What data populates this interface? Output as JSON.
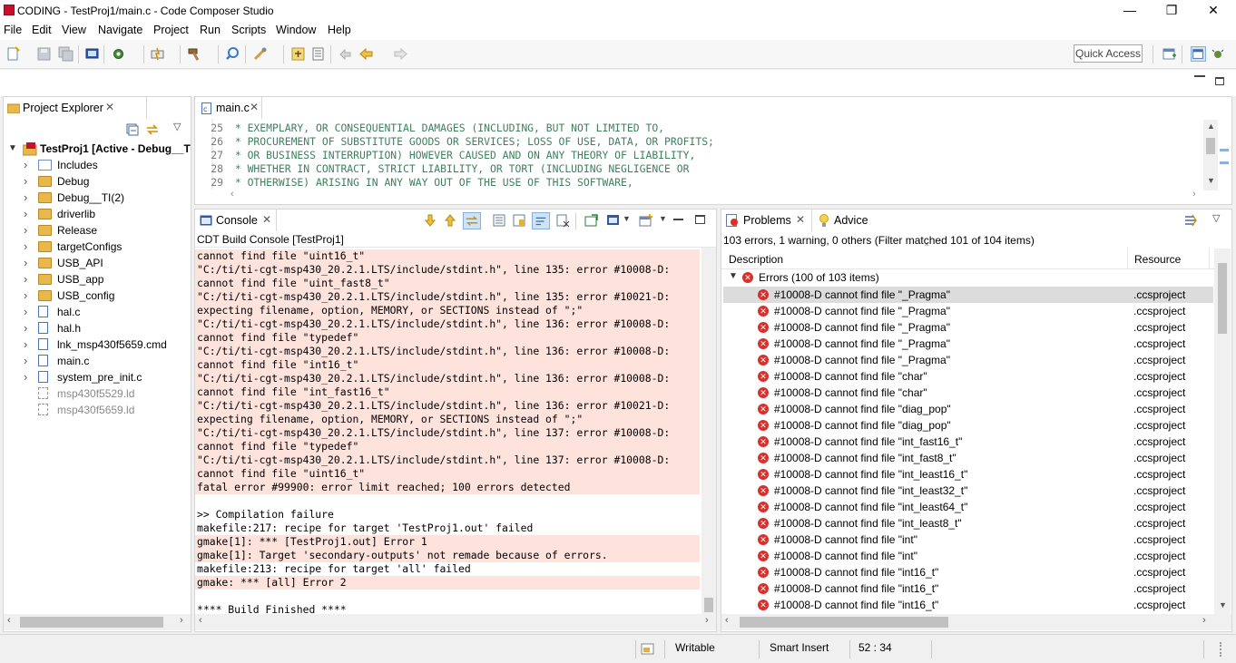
{
  "window": {
    "title": "CODING - TestProj1/main.c - Code Composer Studio",
    "minimize": "—",
    "restore": "❐",
    "close": "✕"
  },
  "menu": [
    "File",
    "Edit",
    "View",
    "Navigate",
    "Project",
    "Run",
    "Scripts",
    "Window",
    "Help"
  ],
  "toolbar": {
    "quick_access": "Quick Access"
  },
  "project_explorer": {
    "tab_label": "Project Explorer",
    "project": "TestProj1  [Active - Debug__TI]",
    "items": [
      {
        "label": "Includes",
        "type": "includes"
      },
      {
        "label": "Debug",
        "type": "folder"
      },
      {
        "label": "Debug__TI(2)",
        "type": "folder"
      },
      {
        "label": "driverlib",
        "type": "folder"
      },
      {
        "label": "Release",
        "type": "folder"
      },
      {
        "label": "targetConfigs",
        "type": "folder"
      },
      {
        "label": "USB_API",
        "type": "folder"
      },
      {
        "label": "USB_app",
        "type": "folder"
      },
      {
        "label": "USB_config",
        "type": "folder"
      },
      {
        "label": "hal.c",
        "type": "c"
      },
      {
        "label": "hal.h",
        "type": "h"
      },
      {
        "label": "lnk_msp430f5659.cmd",
        "type": "cmd"
      },
      {
        "label": "main.c",
        "type": "c"
      },
      {
        "label": "system_pre_init.c",
        "type": "c"
      },
      {
        "label": "msp430f5529.ld",
        "type": "ld"
      },
      {
        "label": "msp430f5659.ld",
        "type": "ld"
      }
    ]
  },
  "editor": {
    "tab_label": "main.c",
    "lines": [
      {
        "num": "25",
        "text": " * EXEMPLARY, OR CONSEQUENTIAL DAMAGES (INCLUDING, BUT NOT LIMITED TO,"
      },
      {
        "num": "26",
        "text": " * PROCUREMENT OF SUBSTITUTE GOODS OR SERVICES; LOSS OF USE, DATA, OR PROFITS;"
      },
      {
        "num": "27",
        "text": " * OR BUSINESS INTERRUPTION) HOWEVER CAUSED AND ON ANY THEORY OF LIABILITY,"
      },
      {
        "num": "28",
        "text": " * WHETHER IN CONTRACT, STRICT LIABILITY, OR TORT (INCLUDING NEGLIGENCE OR"
      },
      {
        "num": "29",
        "text": " * OTHERWISE) ARISING IN ANY WAY OUT OF THE USE OF THIS SOFTWARE,"
      }
    ]
  },
  "console": {
    "tab_label": "Console",
    "header": "CDT Build Console [TestProj1]",
    "lines": [
      {
        "text": "cannot find file \"uint16_t\"",
        "error": true
      },
      {
        "text": "\"C:/ti/ti-cgt-msp430_20.2.1.LTS/include/stdint.h\", line 135: error #10008-D:",
        "error": true
      },
      {
        "text": "cannot find file \"uint_fast8_t\"",
        "error": true
      },
      {
        "text": "\"C:/ti/ti-cgt-msp430_20.2.1.LTS/include/stdint.h\", line 135: error #10021-D:",
        "error": true
      },
      {
        "text": "expecting filename, option, MEMORY, or SECTIONS instead of \";\"",
        "error": true
      },
      {
        "text": "\"C:/ti/ti-cgt-msp430_20.2.1.LTS/include/stdint.h\", line 136: error #10008-D:",
        "error": true
      },
      {
        "text": "cannot find file \"typedef\"",
        "error": true
      },
      {
        "text": "\"C:/ti/ti-cgt-msp430_20.2.1.LTS/include/stdint.h\", line 136: error #10008-D:",
        "error": true
      },
      {
        "text": "cannot find file \"int16_t\"",
        "error": true
      },
      {
        "text": "\"C:/ti/ti-cgt-msp430_20.2.1.LTS/include/stdint.h\", line 136: error #10008-D:",
        "error": true
      },
      {
        "text": "cannot find file \"int_fast16_t\"",
        "error": true
      },
      {
        "text": "\"C:/ti/ti-cgt-msp430_20.2.1.LTS/include/stdint.h\", line 136: error #10021-D:",
        "error": true
      },
      {
        "text": "expecting filename, option, MEMORY, or SECTIONS instead of \";\"",
        "error": true
      },
      {
        "text": "\"C:/ti/ti-cgt-msp430_20.2.1.LTS/include/stdint.h\", line 137: error #10008-D:",
        "error": true
      },
      {
        "text": "cannot find file \"typedef\"",
        "error": true
      },
      {
        "text": "\"C:/ti/ti-cgt-msp430_20.2.1.LTS/include/stdint.h\", line 137: error #10008-D:",
        "error": true
      },
      {
        "text": "cannot find file \"uint16_t\"",
        "error": true
      },
      {
        "text": "fatal error #99900: error limit reached; 100 errors detected",
        "error": true
      },
      {
        "text": "",
        "error": false
      },
      {
        "text": ">> Compilation failure",
        "error": false
      },
      {
        "text": "makefile:217: recipe for target 'TestProj1.out' failed",
        "error": false
      },
      {
        "text": "gmake[1]: *** [TestProj1.out] Error 1",
        "error": true
      },
      {
        "text": "gmake[1]: Target 'secondary-outputs' not remade because of errors.",
        "error": true
      },
      {
        "text": "makefile:213: recipe for target 'all' failed",
        "error": false
      },
      {
        "text": "gmake: *** [all] Error 2",
        "error": true
      },
      {
        "text": "",
        "error": false
      },
      {
        "text": "**** Build Finished ****",
        "error": false
      }
    ]
  },
  "problems": {
    "tab_label": "Problems",
    "advice_tab": "Advice",
    "summary": "103 errors, 1 warning, 0 others (Filter matched 101 of 104 items)",
    "col_description": "Description",
    "col_resource": "Resource",
    "group": "Errors (100 of 103 items)",
    "rows": [
      {
        "desc": "#10008-D cannot find file \"_Pragma\"",
        "res": ".ccsproject"
      },
      {
        "desc": "#10008-D cannot find file \"_Pragma\"",
        "res": ".ccsproject"
      },
      {
        "desc": "#10008-D cannot find file \"_Pragma\"",
        "res": ".ccsproject"
      },
      {
        "desc": "#10008-D cannot find file \"_Pragma\"",
        "res": ".ccsproject"
      },
      {
        "desc": "#10008-D cannot find file \"_Pragma\"",
        "res": ".ccsproject"
      },
      {
        "desc": "#10008-D cannot find file \"char\"",
        "res": ".ccsproject"
      },
      {
        "desc": "#10008-D cannot find file \"char\"",
        "res": ".ccsproject"
      },
      {
        "desc": "#10008-D cannot find file \"diag_pop\"",
        "res": ".ccsproject"
      },
      {
        "desc": "#10008-D cannot find file \"diag_pop\"",
        "res": ".ccsproject"
      },
      {
        "desc": "#10008-D cannot find file \"int_fast16_t\"",
        "res": ".ccsproject"
      },
      {
        "desc": "#10008-D cannot find file \"int_fast8_t\"",
        "res": ".ccsproject"
      },
      {
        "desc": "#10008-D cannot find file \"int_least16_t\"",
        "res": ".ccsproject"
      },
      {
        "desc": "#10008-D cannot find file \"int_least32_t\"",
        "res": ".ccsproject"
      },
      {
        "desc": "#10008-D cannot find file \"int_least64_t\"",
        "res": ".ccsproject"
      },
      {
        "desc": "#10008-D cannot find file \"int_least8_t\"",
        "res": ".ccsproject"
      },
      {
        "desc": "#10008-D cannot find file \"int\"",
        "res": ".ccsproject"
      },
      {
        "desc": "#10008-D cannot find file \"int\"",
        "res": ".ccsproject"
      },
      {
        "desc": "#10008-D cannot find file \"int16_t\"",
        "res": ".ccsproject"
      },
      {
        "desc": "#10008-D cannot find file \"int16_t\"",
        "res": ".ccsproject"
      },
      {
        "desc": "#10008-D cannot find file \"int16_t\"",
        "res": ".ccsproject"
      }
    ]
  },
  "statusbar": {
    "writable": "Writable",
    "insert_mode": "Smart Insert",
    "position": "52 : 34"
  }
}
